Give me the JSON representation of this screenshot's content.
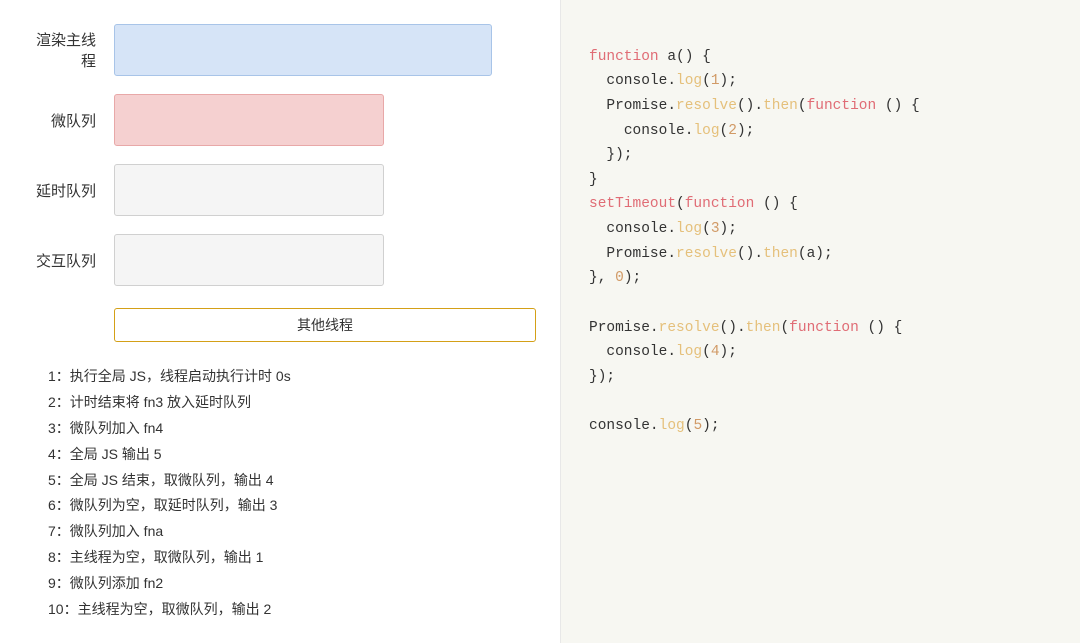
{
  "left": {
    "queues": [
      {
        "id": "main",
        "label": "渲染主线程",
        "boxClass": "queue-box-main"
      },
      {
        "id": "micro",
        "label": "微队列",
        "boxClass": "queue-box-micro"
      },
      {
        "id": "delay",
        "label": "延时队列",
        "boxClass": "queue-box-delay"
      },
      {
        "id": "interact",
        "label": "交互队列",
        "boxClass": "queue-box-interact"
      }
    ],
    "other_thread_label": "其他线程",
    "steps": [
      "1：执行全局 JS，线程启动执行计时 0s",
      "2：计时结束将 fn3 放入延时队列",
      "3：微队列加入 fn4",
      "4：全局 JS 输出 5",
      "5：全局 JS 结束，取微队列，输出 4",
      "6：微队列为空，取延时队列，输出 3",
      "7：微队列加入 fna",
      "8：主线程为空，取微队列，输出 1",
      "9：微队列添加 fn2",
      "10：主线程为空，取微队列，输出 2"
    ]
  },
  "right": {
    "code_lines": []
  }
}
